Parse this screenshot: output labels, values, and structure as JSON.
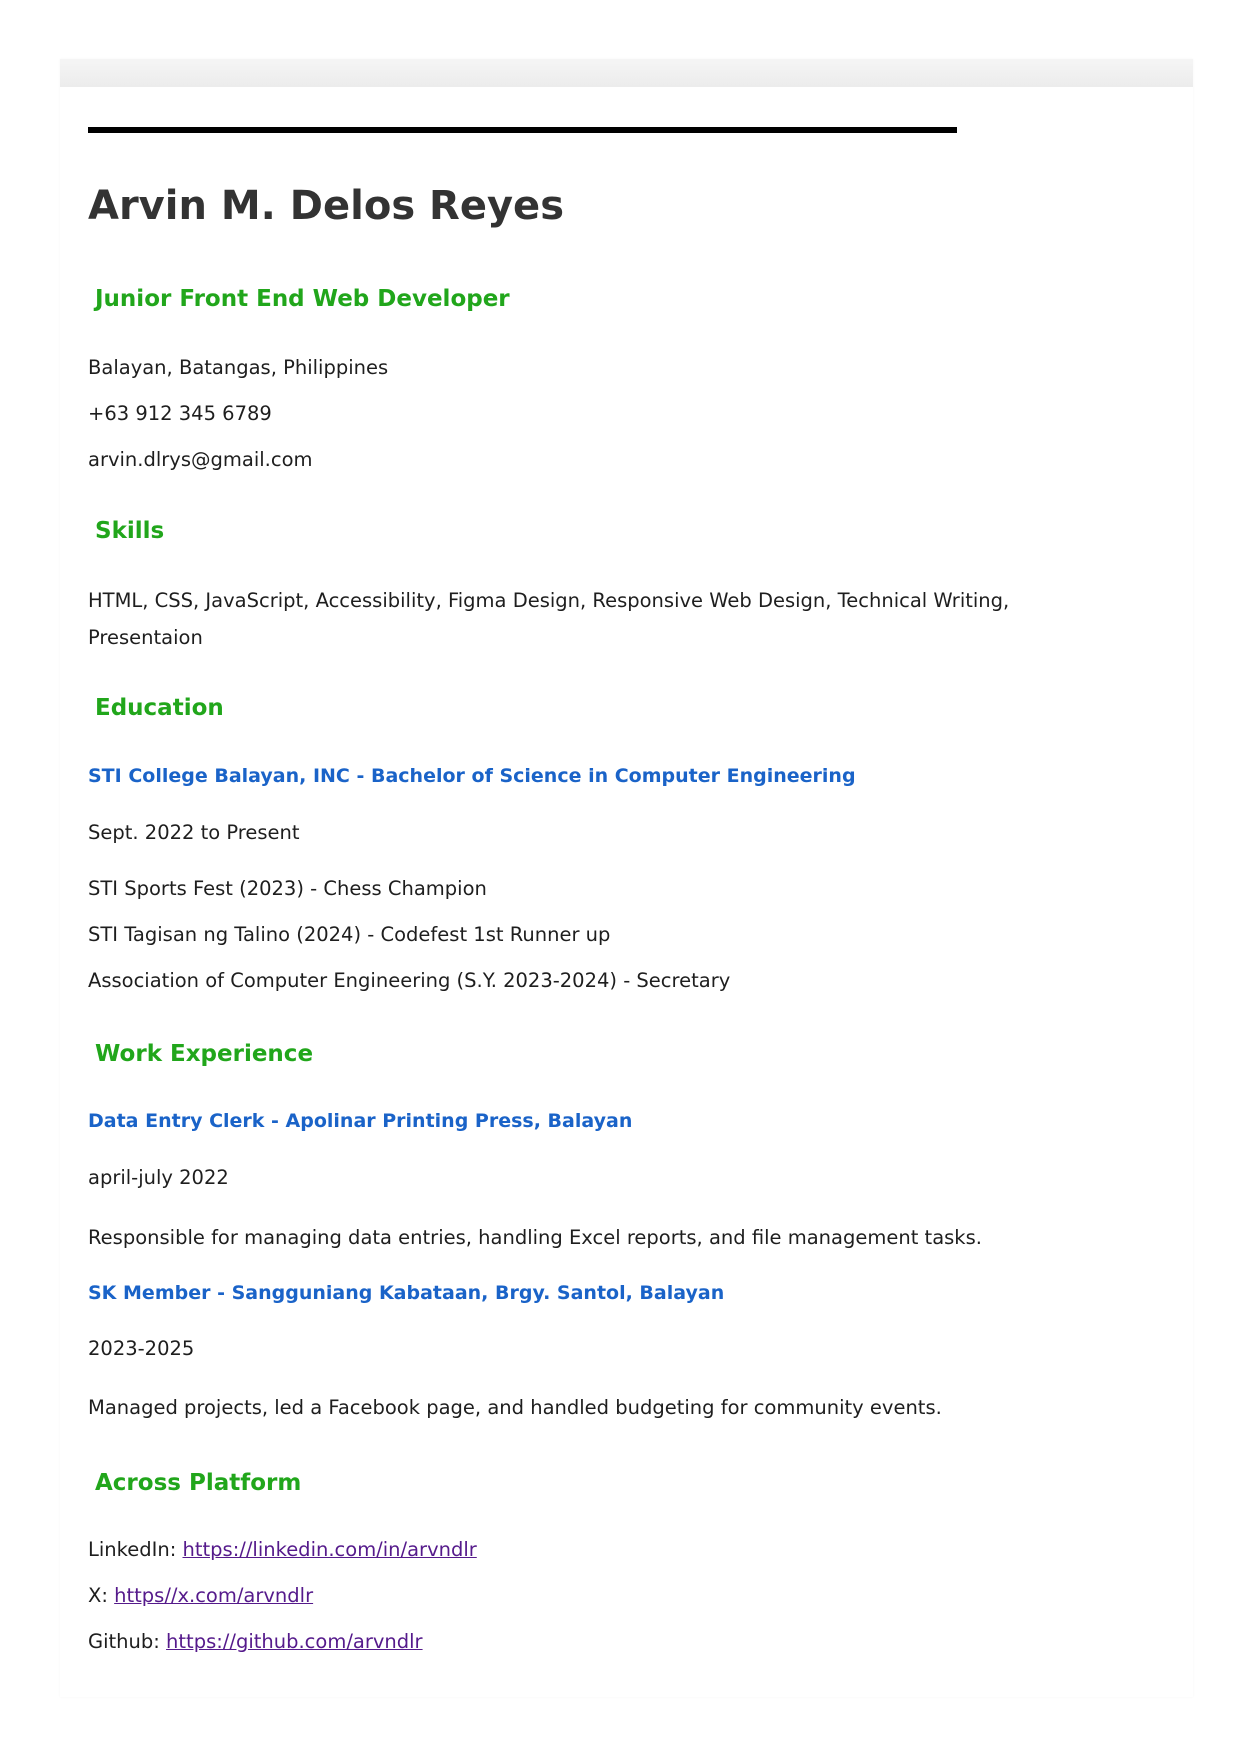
{
  "name": "Arvin M. Delos Reyes",
  "title": "Junior Front End Web Developer",
  "contact": {
    "location": "Balayan, Batangas, Philippines",
    "phone": "+63 912 345 6789",
    "email": "arvin.dlrys@gmail.com"
  },
  "skills": {
    "heading": "Skills",
    "text": "HTML, CSS, JavaScript, Accessibility, Figma Design, Responsive Web Design, Technical Writing, Presentaion"
  },
  "education": {
    "heading": "Education",
    "school": "STI College Balayan, INC - Bachelor of Science in Computer Engineering",
    "dates": "Sept. 2022 to Present",
    "achievements": [
      "STI Sports Fest (2023) - Chess Champion",
      "STI Tagisan ng Talino (2024) - Codefest 1st Runner up",
      "Association of Computer Engineering (S.Y. 2023-2024) - Secretary"
    ]
  },
  "work": {
    "heading": "Work Experience",
    "jobs": [
      {
        "title": "Data Entry Clerk - Apolinar Printing Press, Balayan",
        "dates": "april-july 2022",
        "description": "Responsible for managing data entries, handling Excel reports, and file management tasks."
      },
      {
        "title": "SK Member - Sangguniang Kabataan, Brgy. Santol, Balayan",
        "dates": "2023-2025",
        "description": "Managed projects, led a Facebook page, and handled budgeting for community events."
      }
    ]
  },
  "platforms": {
    "heading": "Across Platform",
    "items": [
      {
        "label": "LinkedIn:",
        "url": "https://linkedin.com/in/arvndlr"
      },
      {
        "label": "X:",
        "url": "https//x.com/arvndlr"
      },
      {
        "label": "Github:",
        "url": "https://github.com/arvndlr"
      }
    ]
  },
  "colors": {
    "heading": "#21a61b",
    "subheading": "#1a63c8",
    "link": "#551a8b"
  }
}
